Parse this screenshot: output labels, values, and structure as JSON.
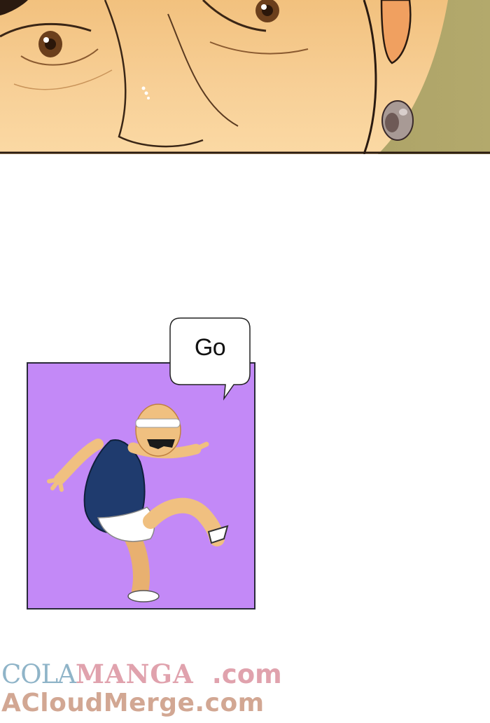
{
  "speech_bubble": {
    "text": "Go"
  },
  "watermark": {
    "line1_part1": "COLA",
    "line1_part2": "MANGA",
    "line1_part3": ".com",
    "line2": "ACloudMerge.com"
  },
  "colors": {
    "skin": "#f6c98e",
    "panel_bg": "#c389f7",
    "wall": "#a39a5e",
    "tank_top": "#1f3b6e"
  }
}
